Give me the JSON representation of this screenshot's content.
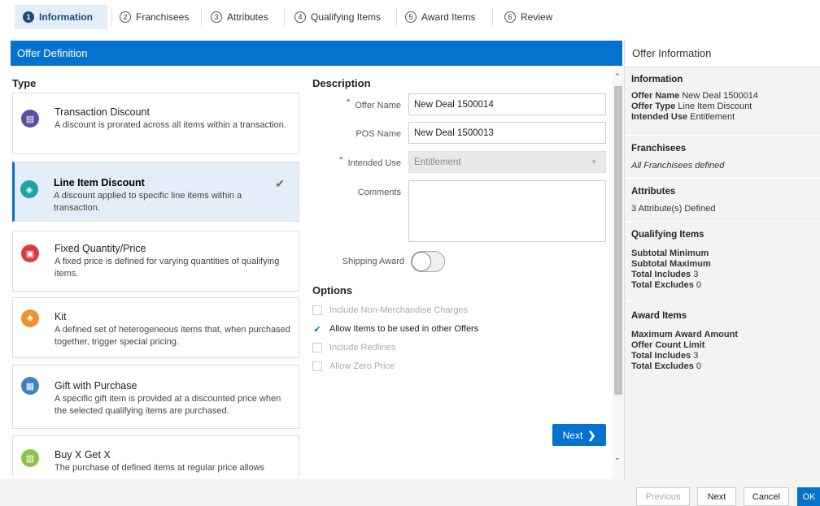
{
  "steps": [
    {
      "num": "1",
      "label": "Information"
    },
    {
      "num": "2",
      "label": "Franchisees"
    },
    {
      "num": "3",
      "label": "Attributes"
    },
    {
      "num": "4",
      "label": "Qualifying Items"
    },
    {
      "num": "5",
      "label": "Award Items"
    },
    {
      "num": "6",
      "label": "Review"
    }
  ],
  "header": {
    "title": "Offer Definition"
  },
  "type": {
    "heading": "Type",
    "cards": [
      {
        "title": "Transaction Discount",
        "desc": "A discount is prorated across all items within a transaction.",
        "color": "#5a4fa3",
        "icon": "receipt-icon",
        "glyph": "▤"
      },
      {
        "title": "Line Item Discount",
        "desc": "A discount applied to specific line items within a transaction.",
        "color": "#1aa5a0",
        "icon": "tag-icon",
        "glyph": "◈"
      },
      {
        "title": "Fixed Quantity/Price",
        "desc": "A fixed price is defined for varying quantities of qualifying items.",
        "color": "#e0393e",
        "icon": "lock-icon",
        "glyph": "▣"
      },
      {
        "title": "Kit",
        "desc": "A defined set of heterogeneous items that, when purchased together, trigger special pricing.",
        "color": "#f0952d",
        "icon": "kit-icon",
        "glyph": "♣"
      },
      {
        "title": "Gift with Purchase",
        "desc": "A specific gift item is provided at a discounted price when the selected qualifying items are purchased.",
        "color": "#3e82c4",
        "icon": "gift-icon",
        "glyph": "▦"
      },
      {
        "title": "Buy X Get X",
        "desc": "The purchase of defined items at regular price allows",
        "color": "#8cc44a",
        "icon": "buy-get-icon",
        "glyph": "▥"
      }
    ]
  },
  "description": {
    "heading": "Description",
    "offer_name_label": "Offer Name",
    "offer_name_value": "New Deal 1500014",
    "pos_name_label": "POS Name",
    "pos_name_value": "New Deal 1500013",
    "intended_use_label": "Intended Use",
    "intended_use_value": "Entitlement",
    "comments_label": "Comments",
    "shipping_award_label": "Shipping Award",
    "shipping_award_on": false
  },
  "options": {
    "heading": "Options",
    "items": [
      {
        "label": "Include Non-Merchandise Charges",
        "checked": false
      },
      {
        "label": "Allow Items to be used in other Offers",
        "checked": true
      },
      {
        "label": "Include Redlines",
        "checked": false
      },
      {
        "label": "Allow Zero Price",
        "checked": false
      }
    ]
  },
  "next_label": "Next",
  "offer_info": {
    "title": "Offer Information",
    "information": {
      "heading": "Information",
      "offer_name_key": "Offer Name",
      "offer_name_val": "New Deal 1500014",
      "offer_type_key": "Offer Type",
      "offer_type_val": "Line Item Discount",
      "intended_use_key": "Intended Use",
      "intended_use_val": "Entitlement"
    },
    "franchisees": {
      "heading": "Franchisees",
      "text": "All Franchisees defined"
    },
    "attributes": {
      "heading": "Attributes",
      "text": "3 Attribute(s) Defined"
    },
    "qualifying": {
      "heading": "Qualifying Items",
      "subtotal_min": "Subtotal Minimum",
      "subtotal_max": "Subtotal Maximum",
      "incl_key": "Total Includes",
      "incl_val": "3",
      "excl_key": "Total Excludes",
      "excl_val": "0"
    },
    "award": {
      "heading": "Award Items",
      "max_amount": "Maximum Award Amount",
      "count_limit": "Offer Count Limit",
      "incl_key": "Total Includes",
      "incl_val": "3",
      "excl_key": "Total Excludes",
      "excl_val": "0"
    }
  },
  "footer": {
    "previous": "Previous",
    "next": "Next",
    "cancel": "Cancel",
    "ok": "OK"
  }
}
